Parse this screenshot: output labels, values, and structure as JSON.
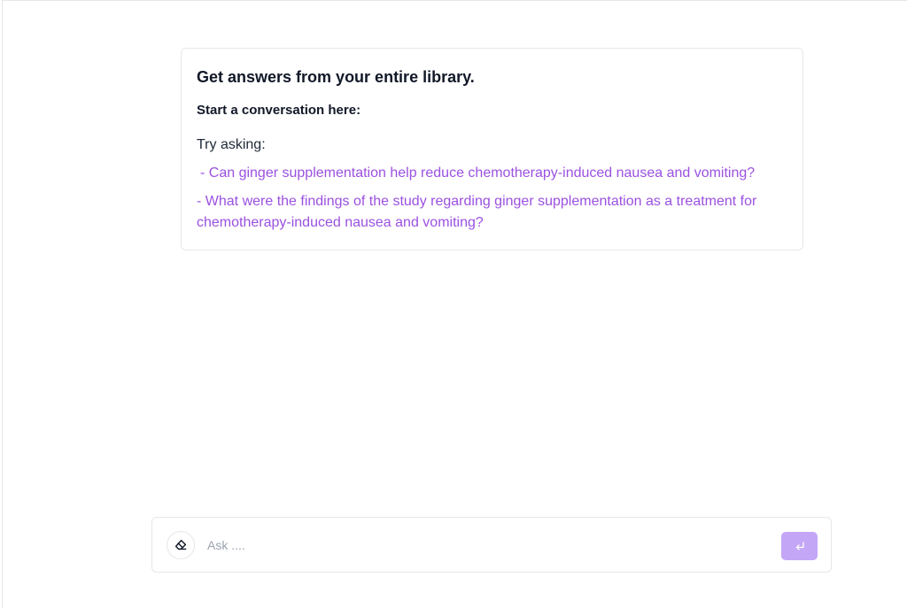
{
  "intro": {
    "title": "Get answers from your entire library.",
    "subtitle": "Start a conversation here:",
    "try_label": "Try asking:",
    "suggestions": [
      "- Can ginger supplementation help reduce chemotherapy-induced nausea and vomiting?",
      "- What were the findings of the study regarding ginger supplementation as a treatment for chemotherapy-induced nausea and vomiting?"
    ]
  },
  "composer": {
    "placeholder": "Ask ....",
    "value": "",
    "clear_icon": "eraser-icon",
    "send_icon": "enter-return-icon"
  },
  "colors": {
    "suggestion_text": "#9b51e0",
    "send_button_bg": "#c4a6f7",
    "border": "#e5e7eb"
  }
}
